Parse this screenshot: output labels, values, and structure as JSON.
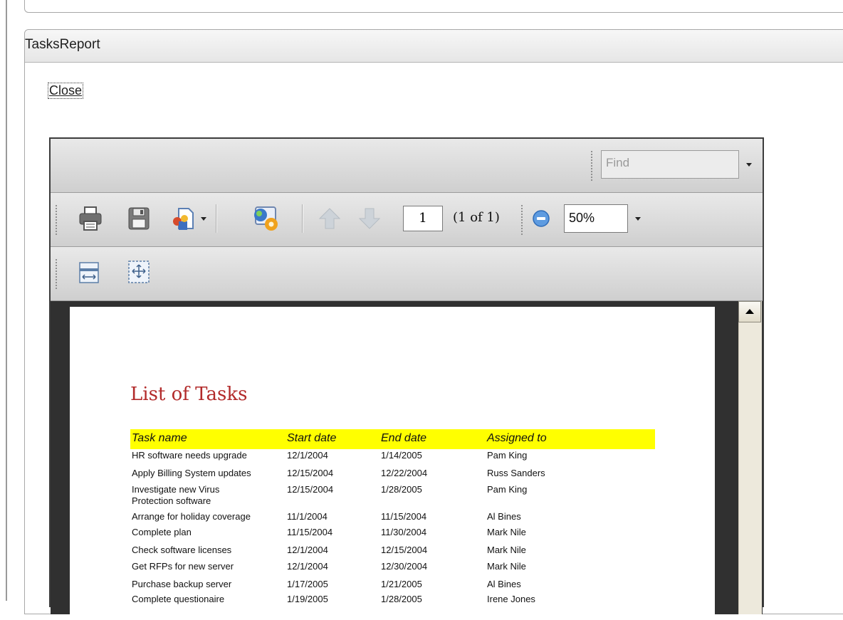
{
  "panel": {
    "title": "TasksReport",
    "close_label": "Close"
  },
  "viewer": {
    "find_placeholder": "Find",
    "page_number": "1",
    "page_of": "(1 of 1)",
    "zoom": "50%",
    "icons": [
      "print-icon",
      "save-icon",
      "export-icon",
      "web-layout-icon",
      "prev-page-icon",
      "next-page-icon",
      "zoom-out-icon",
      "page-width-icon",
      "whole-page-icon"
    ]
  },
  "report": {
    "title": "List of Tasks",
    "columns": [
      "Task name",
      "Start date",
      "End date",
      "Assigned to"
    ],
    "rows": [
      {
        "task": "HR software needs upgrade",
        "start": "12/1/2004",
        "end": "1/14/2005",
        "assigned": "Pam King"
      },
      {
        "task": "Apply Billing System updates",
        "start": "12/15/2004",
        "end": "12/22/2004",
        "assigned": "Russ Sanders"
      },
      {
        "task": "Investigate new Virus",
        "task2": "Protection software",
        "start": "12/15/2004",
        "end": "1/28/2005",
        "assigned": "Pam King"
      },
      {
        "task": "Arrange for holiday coverage",
        "start": "11/1/2004",
        "end": "11/15/2004",
        "assigned": "Al Bines"
      },
      {
        "task": "Complete plan",
        "start": "11/15/2004",
        "end": "11/30/2004",
        "assigned": "Mark Nile"
      },
      {
        "task": "Check software licenses",
        "start": "12/1/2004",
        "end": "12/15/2004",
        "assigned": "Mark Nile"
      },
      {
        "task": "Get RFPs for new server",
        "start": "12/1/2004",
        "end": "12/30/2004",
        "assigned": "Mark Nile"
      },
      {
        "task": "Purchase backup server",
        "start": "1/17/2005",
        "end": "1/21/2005",
        "assigned": "Al Bines"
      },
      {
        "task": "Complete questionaire",
        "start": "1/19/2005",
        "end": "1/28/2005",
        "assigned": "Irene Jones"
      }
    ]
  }
}
